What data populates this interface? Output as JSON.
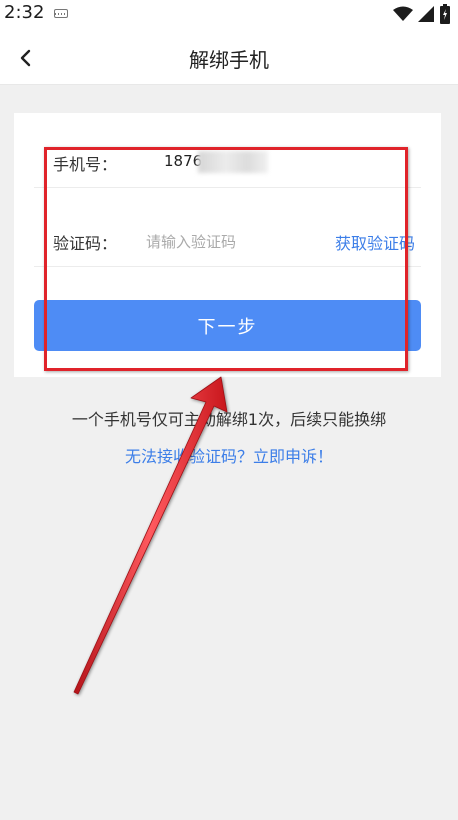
{
  "status_bar": {
    "time": "2:32",
    "icons": [
      "keyboard-icon",
      "wifi-icon",
      "signal-icon",
      "battery-icon"
    ]
  },
  "header": {
    "title": "解绑手机",
    "back_icon": "back-arrow-icon"
  },
  "form": {
    "phone_label": "手机号：",
    "phone_value": "1876",
    "code_label": "验证码：",
    "code_placeholder": "请输入验证码",
    "get_code_label": "获取验证码",
    "next_button_label": "下一步"
  },
  "notice_text": "一个手机号仅可主动解绑1次，后续只能换绑",
  "appeal_link_text": "无法接收验证码？立即申诉！",
  "colors": {
    "accent_blue": "#4e8cf5",
    "link_blue": "#3c7ee8",
    "annotation_red": "#e0232a",
    "background": "#f0f0f0"
  }
}
